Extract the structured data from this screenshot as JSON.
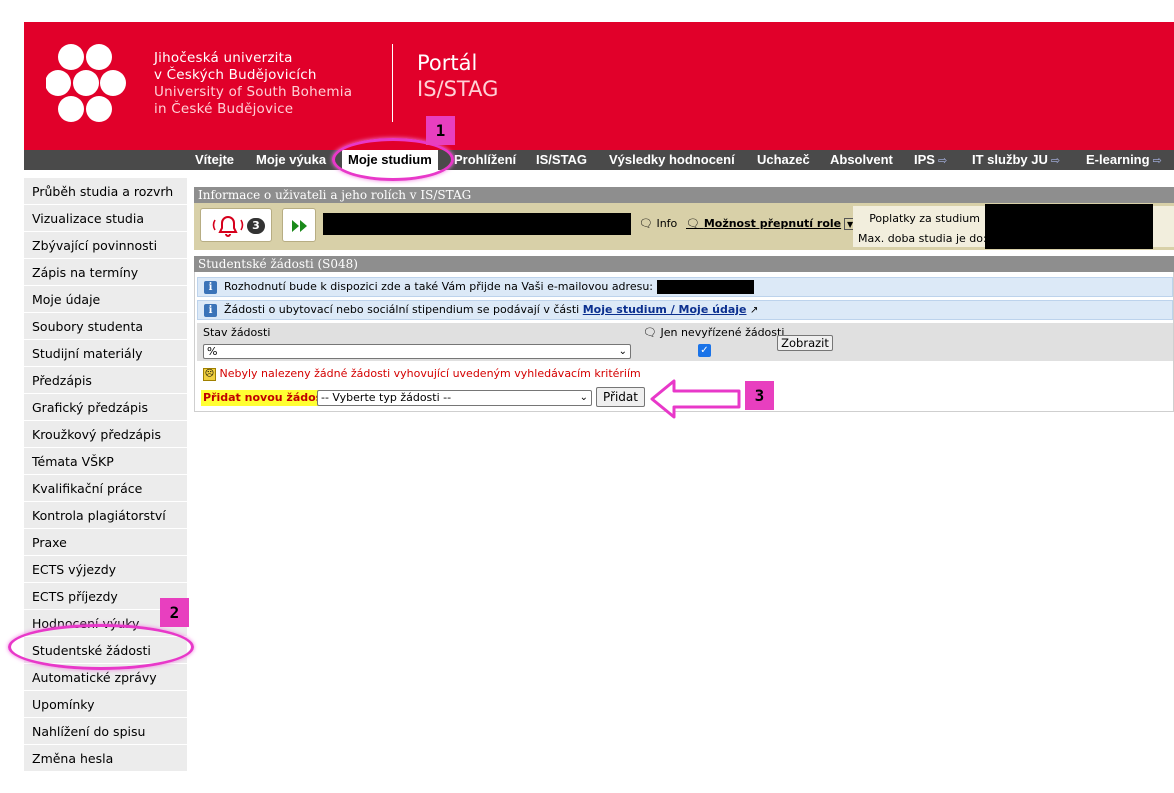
{
  "header": {
    "uni_name_cz_1": "Jihočeská univerzita",
    "uni_name_cz_2": "v Českých Budějovicích",
    "uni_name_en_1": "University of South Bohemia",
    "uni_name_en_2": "in České Budějovice",
    "portal_title": "Portál",
    "portal_subtitle": "IS/STAG",
    "brand_color": "#e1002a"
  },
  "nav": {
    "items": [
      "Vítejte",
      "Moje výuka",
      "Moje studium",
      "Prohlížení",
      "IS/STAG",
      "Výsledky hodnocení",
      "Uchazeč",
      "Absolvent",
      "IPS",
      "IT služby JU",
      "E-learning"
    ],
    "active": "Moje studium",
    "external_icon": "⇨"
  },
  "sidebar": {
    "items": [
      "Průběh studia a rozvrh",
      "Vizualizace studia",
      "Zbývající povinnosti",
      "Zápis na termíny",
      "Moje údaje",
      "Soubory studenta",
      "Studijní materiály",
      "Předzápis",
      "Grafický předzápis",
      "Kroužkový předzápis",
      "Témata VŠKP",
      "Kvalifikační práce",
      "Kontrola plagiátorství",
      "Praxe",
      "ECTS výjezdy",
      "ECTS příjezdy",
      "Hodnocení výuky",
      "Studentské žádosti",
      "Automatické zprávy",
      "Upomínky",
      "Nahlížení do spisu",
      "Změna hesla"
    ],
    "selected": "Studentské žádosti"
  },
  "user_panel": {
    "title": "Informace o uživateli a jeho rolích v IS/STAG",
    "notification_count": "3",
    "info_label": "Info",
    "switch_role_label": "Možnost přepnutí role",
    "fees_label": "Poplatky za studium",
    "max_duration_label": "Max. doba studia je do:"
  },
  "requests": {
    "title": "Studentské žádosti (S048)",
    "info_email": "Rozhodnutí bude k dispozici zde a také Vám přijde na Vaši e-mailovou adresu:",
    "info_housing": "Žádosti o ubytovací nebo sociální stipendium se podávají v části",
    "info_link": "Moje studium / Moje údaje",
    "status_label": "Stav žádosti",
    "status_value": "%",
    "unresolved_label": "Jen nevyřízené žádosti",
    "unresolved_checked": true,
    "show_button": "Zobrazit",
    "no_results": "Nebyly nalezeny žádné žádosti vyhovující uvedeným vyhledávacím kritériím",
    "add_label": "Přidat novou žádost:",
    "add_select_value": "-- Vyberte typ žádosti --",
    "add_button": "Přidat"
  },
  "annotations": {
    "step1": "1",
    "step2": "2",
    "step3": "3",
    "color": "#e83fbf"
  }
}
